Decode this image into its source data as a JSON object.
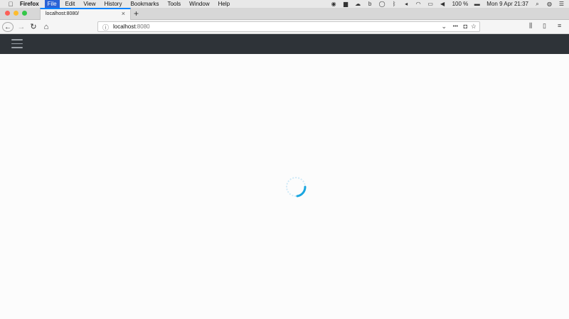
{
  "menubar": {
    "app_name": "Firefox",
    "items": [
      "File",
      "Edit",
      "View",
      "History",
      "Bookmarks",
      "Tools",
      "Window",
      "Help"
    ],
    "battery": "100 %",
    "datetime": "Mon 9 Apr  21:37"
  },
  "tab": {
    "title": "localhost:8080/",
    "close": "×",
    "new_tab": "+"
  },
  "toolbar": {
    "host": "localhost",
    "port": ":8080",
    "page_actions": "•••"
  },
  "colors": {
    "app_header": "#2e3338",
    "spinner": "#1aa6e0",
    "tab_accent": "#0a84ff"
  },
  "status": {
    "loading": true
  }
}
